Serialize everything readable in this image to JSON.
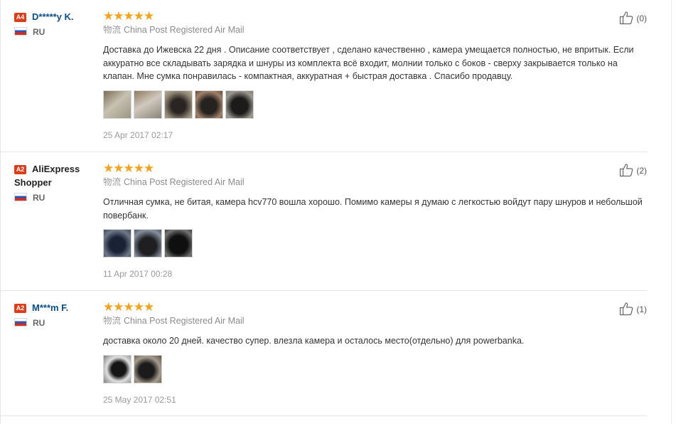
{
  "reviews": [
    {
      "badge": "A4",
      "name_lines": [
        "D*****y K."
      ],
      "country": "RU",
      "stars": "★★★★★",
      "shipping_label": "物流",
      "shipping": "China Post Registered Air Mail",
      "text": "Доставка до Ижевска 22 дня . Описание соответствует , сделано качественно , камера умещается полностью, не впритык. Если аккуратно все складывать зарядка и шнуры из комплекта всё входит, молнии только с боков - сверху закрывается только на клапан. Мне сумка понравилась - компактная, аккуратная + быстрая доставка . Спасибо продавцу.",
      "photos": [
        "photo-1",
        "photo-2",
        "photo-3",
        "photo-4",
        "photo-5"
      ],
      "date": "25 Apr 2017 02:17",
      "helpful": "(0)"
    },
    {
      "badge": "A2",
      "name_lines": [
        "AliExpress",
        "Shopper"
      ],
      "country": "RU",
      "stars": "★★★★★",
      "shipping_label": "物流",
      "shipping": "China Post Registered Air Mail",
      "text": "Отличная сумка, не битая, камера hcv770 вошла хорошо. Помимо камеры я думаю с легкостью войдут пару шнуров и небольшой повербанк.",
      "photos": [
        "photo-1",
        "photo-2",
        "photo-3"
      ],
      "date": "11 Apr 2017 00:28",
      "helpful": "(2)"
    },
    {
      "badge": "A2",
      "name_lines": [
        "M***m F."
      ],
      "country": "RU",
      "stars": "★★★★★",
      "shipping_label": "物流",
      "shipping": "China Post Registered Air Mail",
      "text": "доставка около 20 дней. качество супер. влезла камера и осталось место(отдельно) для powerbanka.",
      "photos": [
        "photo-1",
        "photo-2"
      ],
      "date": "25 May 2017 02:51",
      "helpful": "(1)"
    }
  ],
  "icons": {
    "helpful": "thumbs-up-icon",
    "country_flag": "russia-flag-icon"
  },
  "colors": {
    "star": "#f5a31a",
    "badge": "#e03b17",
    "username": "#0a4e8c"
  }
}
